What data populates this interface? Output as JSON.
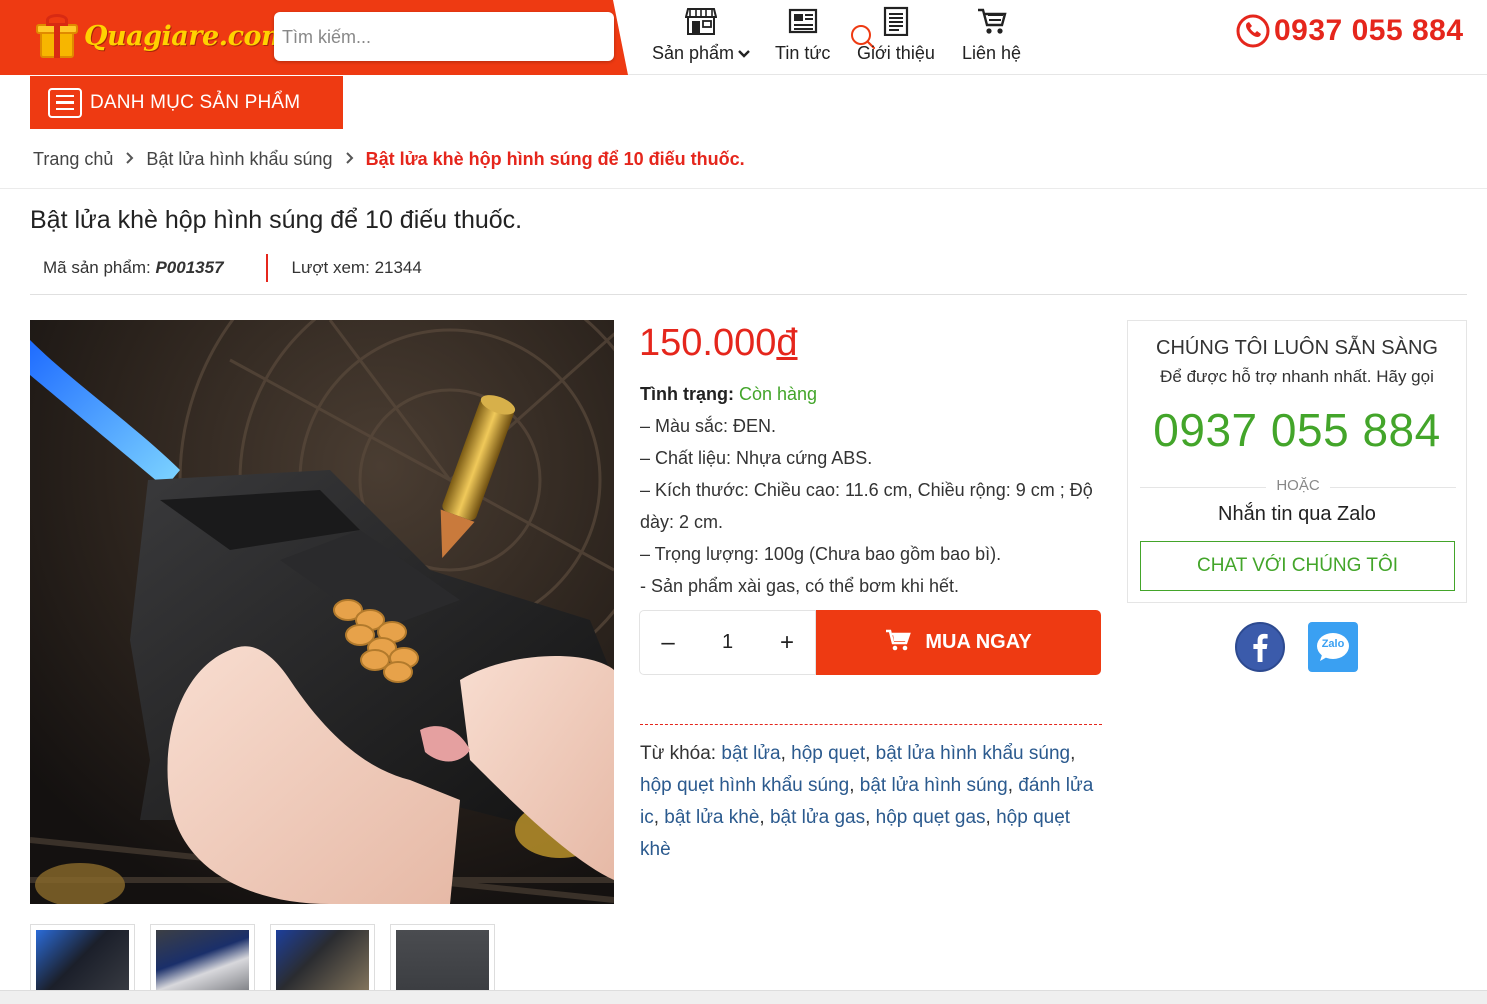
{
  "header": {
    "logo_text": "Quagiare.com",
    "search_placeholder": "Tìm kiếm...",
    "nav": [
      {
        "label": "Sản phẩm"
      },
      {
        "label": "Tin tức"
      },
      {
        "label": "Giới thiệu"
      },
      {
        "label": "Liên hệ"
      }
    ],
    "hotline": "0937 055 884",
    "brand_color": "#ee3a12"
  },
  "category_button": "DANH MỤC SẢN PHẨM",
  "breadcrumb": {
    "home": "Trang chủ",
    "category": "Bật lửa hình khẩu súng",
    "current": "Bật lửa khè hộp hình súng để 10 điếu thuốc."
  },
  "product": {
    "title": "Bật lửa khè hộp hình súng để 10 điếu thuốc.",
    "sku_label": "Mã sản phẩm:",
    "sku": "P001357",
    "views_label": "Lượt xem:",
    "views": "21344",
    "price_number": "150.000",
    "price_currency": "đ",
    "status_label": "Tình trạng:",
    "status_value": "Còn hàng",
    "specs": [
      "– Màu sắc: ĐEN.",
      "– Chất liệu: Nhựa cứng ABS.",
      "– Kích thước: Chiều cao: 11.6 cm, Chiều rộng: 9 cm ; Độ dày: 2 cm.",
      "– Trọng lượng: 100g (Chưa bao gồm bao bì).",
      "- Sản phẩm xài gas, có thể bơm khi hết."
    ],
    "quantity": "1",
    "buy_label": "MUA NGAY",
    "tags_label": "Từ khóa:",
    "tags": [
      "bật lửa",
      "hộp quẹt",
      "bật lửa hình khẩu súng",
      "hộp quẹt hình khẩu súng",
      "bật lửa hình súng",
      "đánh lửa ic",
      "bật lửa khè",
      "bật lửa gas",
      "hộp quẹt gas",
      "hộp quẹt khè"
    ]
  },
  "support": {
    "heading": "CHÚNG TÔI LUÔN SẴN SÀNG",
    "subheading": "Để được hỗ trợ nhanh nhất. Hãy gọi",
    "phone": "0937 055 884",
    "or_label": "HOẶC",
    "zalo_text": "Nhắn tin qua Zalo",
    "chat_button": "CHAT VỚI CHÚNG TÔI",
    "zalo_icon_text": "Zalo",
    "accent_color": "#43a52a"
  }
}
